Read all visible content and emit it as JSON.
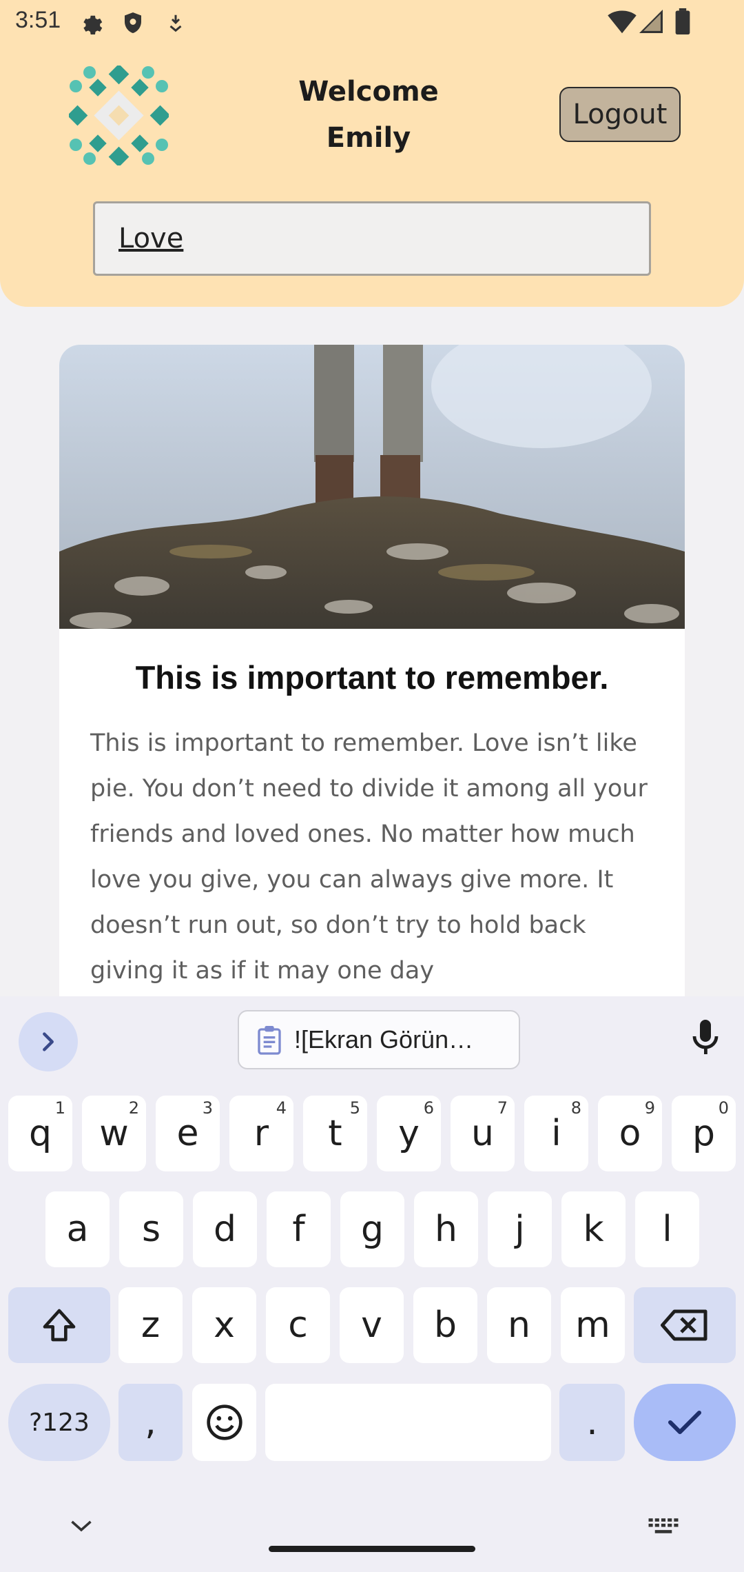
{
  "status": {
    "time": "3:51"
  },
  "header": {
    "welcome_line1": "Welcome",
    "welcome_line2": "Emily",
    "logout_label": "Logout"
  },
  "search": {
    "value": "Love"
  },
  "card": {
    "title": "This is important to remember.",
    "body": "This is important to remember. Love isn’t like pie. You don’t need to divide it among all your friends and loved ones. No matter how much love you give, you can always give more. It doesn’t run out, so don’t try to hold back giving it as if it may one day"
  },
  "keyboard": {
    "clipboard_text": "![Ekran Görün…",
    "row1": [
      {
        "k": "q",
        "h": "1"
      },
      {
        "k": "w",
        "h": "2"
      },
      {
        "k": "e",
        "h": "3"
      },
      {
        "k": "r",
        "h": "4"
      },
      {
        "k": "t",
        "h": "5"
      },
      {
        "k": "y",
        "h": "6"
      },
      {
        "k": "u",
        "h": "7"
      },
      {
        "k": "i",
        "h": "8"
      },
      {
        "k": "o",
        "h": "9"
      },
      {
        "k": "p",
        "h": "0"
      }
    ],
    "row2": [
      "a",
      "s",
      "d",
      "f",
      "g",
      "h",
      "j",
      "k",
      "l"
    ],
    "row3": [
      "z",
      "x",
      "c",
      "v",
      "b",
      "n",
      "m"
    ],
    "symbols_label": "?123",
    "comma_label": ",",
    "period_label": "."
  },
  "colors": {
    "header_bg": "#fee2b3",
    "logout_bg": "#c2b39c",
    "logo_teal": "#3aa99a",
    "keyboard_accent": "#a9bcf7"
  }
}
